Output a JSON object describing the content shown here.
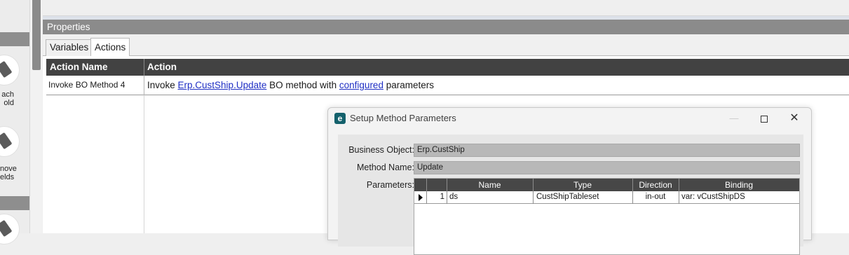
{
  "toolbox": {
    "item1_label_line1": "ach",
    "item1_label_line2": "old",
    "item2_label_line1": "nove",
    "item2_label_line2": "elds"
  },
  "properties": {
    "title": "Properties",
    "tabs": [
      {
        "label": "Variables",
        "active": false
      },
      {
        "label": "Actions",
        "active": true
      }
    ],
    "grid": {
      "columns": [
        "Action Name",
        "Action"
      ],
      "rows": [
        {
          "name": "Invoke BO Method 4",
          "action_prefix": "Invoke ",
          "action_link1": "Erp.CustShip.Update",
          "action_middle": " BO method with ",
          "action_link2": "configured",
          "action_suffix": " parameters"
        }
      ]
    }
  },
  "dialog": {
    "title": "Setup Method Parameters",
    "app_icon_letter": "e",
    "fields": {
      "business_object_label": "Business Object:",
      "business_object_value": "Erp.CustShip",
      "method_name_label": "Method Name:",
      "method_name_value": "Update",
      "parameters_label": "Parameters:"
    },
    "param_grid": {
      "columns": [
        "Name",
        "Type",
        "Direction",
        "Binding"
      ],
      "rows": [
        {
          "index": "1",
          "name": "ds",
          "type": "CustShipTableset",
          "direction": "in-out",
          "binding": "var: vCustShipDS"
        }
      ]
    }
  }
}
